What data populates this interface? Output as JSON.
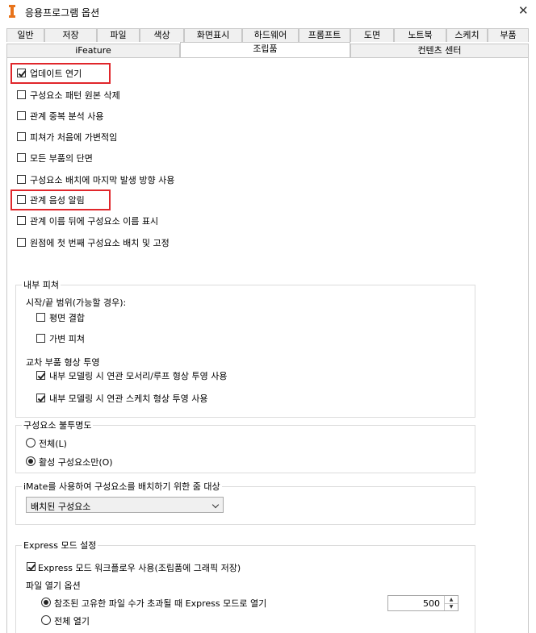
{
  "window": {
    "title": "응용프로그램 옵션",
    "close_glyph": "✕",
    "brand_color": "#e8731a"
  },
  "tabs_row1": [
    "일반",
    "저장",
    "파일",
    "색상",
    "화면표시",
    "하드웨어",
    "프롬프트",
    "도면",
    "노트북",
    "스케치",
    "부품"
  ],
  "tabs_row2": [
    "iFeature",
    "조립품",
    "컨텐츠 센터"
  ],
  "active_tab": "조립품",
  "options": [
    {
      "label": "업데이트 연기",
      "checked": true,
      "highlighted": true
    },
    {
      "label": "구성요소 패턴 원본 삭제",
      "checked": false
    },
    {
      "label": "관계 중복 분석 사용",
      "checked": false
    },
    {
      "label": "피쳐가 처음에 가변적임",
      "checked": false
    },
    {
      "label": "모든 부품의 단면",
      "checked": false
    },
    {
      "label": "구성요소 배치에 마지막 발생 방향 사용",
      "checked": false
    },
    {
      "label": "관계 음성 알림",
      "checked": false,
      "highlighted": true
    },
    {
      "label": "관계 이름 뒤에 구성요소 이름 표시",
      "checked": false
    },
    {
      "label": "원점에 첫 번째 구성요소 배치 및 고정",
      "checked": false
    }
  ],
  "internal_features": {
    "title": "내부 피쳐",
    "range_label": "시작/끝 범위(가능할 경우):",
    "range_options": [
      {
        "label": "평면 결합",
        "checked": false
      },
      {
        "label": "가변 피쳐",
        "checked": false
      }
    ],
    "projection_label": "교차 부품 형상 투영",
    "projection_options": [
      {
        "label": "내부 모델링 시 연관 모서리/루프 형상 투영 사용",
        "checked": true
      },
      {
        "label": "내부 모델링 시 연관 스케치 형상 투영 사용",
        "checked": true
      }
    ]
  },
  "opacity": {
    "title": "구성요소 불투명도",
    "options": [
      {
        "label": "전체(L)",
        "selected": false
      },
      {
        "label": "활성 구성요소만(O)",
        "selected": true
      }
    ]
  },
  "imate": {
    "title": "iMate를 사용하여 구성요소를 배치하기 위한 줌 대상",
    "selected": "배치된 구성요소"
  },
  "express": {
    "title": "Express 모드 설정",
    "workflow_label": "Express 모드 워크플로우 사용(조립품에 그래픽 저장)",
    "workflow_checked": true,
    "open_label": "파일 열기 옵션",
    "open_options": [
      {
        "label": "참조된 고유한 파일 수가 초과될 때 Express 모드로 열기",
        "selected": true
      },
      {
        "label": "전체 열기",
        "selected": false
      }
    ],
    "threshold": "500",
    "spin_up": "▲",
    "spin_down": "▼"
  },
  "highlight_color": "#e0262b"
}
